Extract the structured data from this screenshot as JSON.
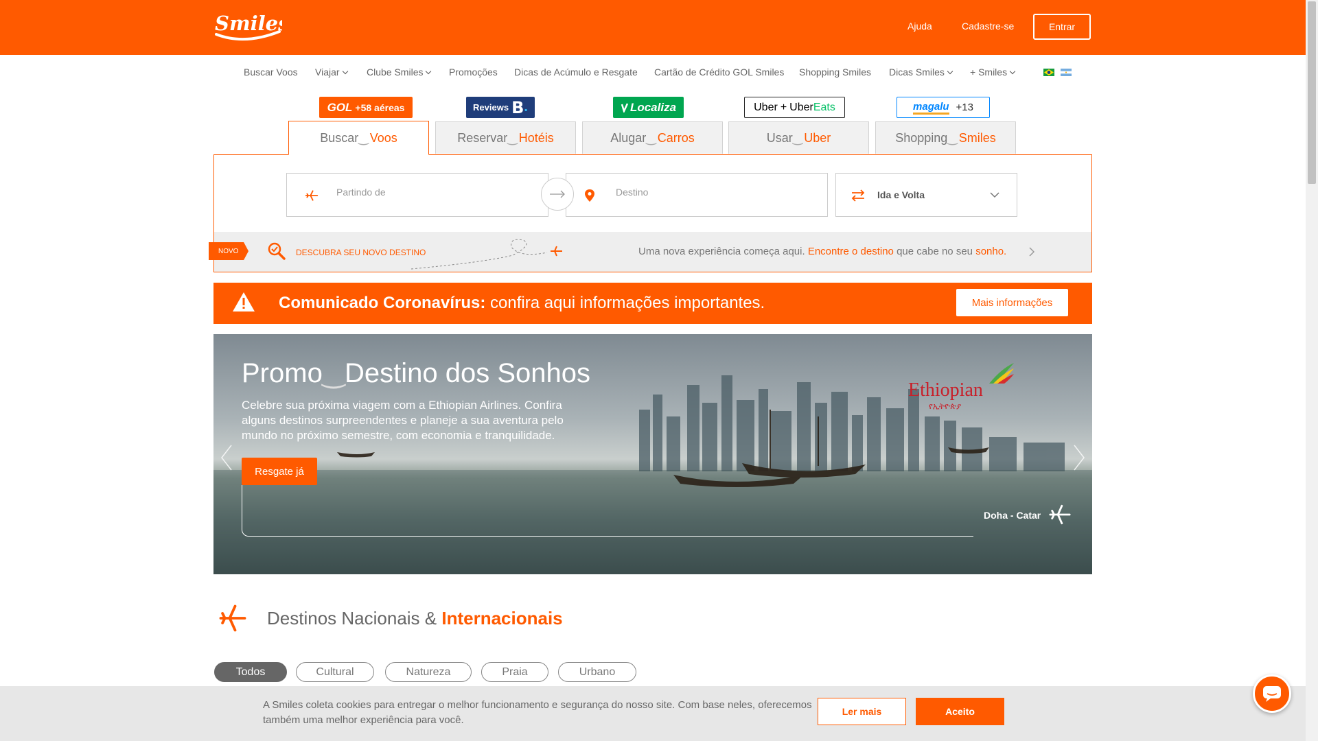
{
  "header": {
    "logo": "Smiles",
    "help": "Ajuda",
    "signup": "Cadastre-se",
    "login": "Entrar"
  },
  "nav": {
    "items": [
      {
        "label": "Buscar Voos",
        "dropdown": false
      },
      {
        "label": "Viajar",
        "dropdown": true
      },
      {
        "label": "Clube Smiles",
        "dropdown": true
      },
      {
        "label": "Promoções",
        "dropdown": false
      },
      {
        "label": "Dicas de Acúmulo e Resgate",
        "dropdown": false
      },
      {
        "label": "Cartão de Crédito GOL Smiles",
        "dropdown": false
      },
      {
        "label": "Shopping Smiles",
        "dropdown": false
      },
      {
        "label": "Dicas Smiles",
        "dropdown": true
      },
      {
        "label": "+ Smiles",
        "dropdown": true
      }
    ],
    "flags": [
      "brazil-flag-icon",
      "argentina-flag-icon"
    ]
  },
  "badges": {
    "gol": {
      "brand": "GOL",
      "text": "+58 aéreas"
    },
    "booking": {
      "brand": "Reviews",
      "letter": "B",
      "dot": "."
    },
    "localiza": {
      "text": "Localiza"
    },
    "uber": {
      "a": "Uber",
      "plus": "+",
      "b": "Uber",
      "c": "Eats"
    },
    "magalu": {
      "brand": "magalu",
      "count": "+13"
    }
  },
  "tabs": [
    {
      "verb": "Buscar",
      "noun": "Voos"
    },
    {
      "verb": "Reservar",
      "noun": "Hotéis"
    },
    {
      "verb": "Alugar",
      "noun": "Carros"
    },
    {
      "verb": "Usar",
      "noun": "Uber"
    },
    {
      "verb": "Shopping",
      "noun": "Smiles"
    }
  ],
  "search": {
    "origin_placeholder": "Partindo de",
    "destination_placeholder": "Destino",
    "trip_type": "Ida e Volta"
  },
  "discover": {
    "badge": "NOVO",
    "link": "DESCUBRA SEU NOVO DESTINO",
    "msg_pre": "Uma nova experiência começa aqui.",
    "msg_link": "Encontre o destino",
    "msg_mid": "que cabe no seu",
    "msg_end": "sonho."
  },
  "corona": {
    "bold": "Comunicado Coronavírus:",
    "rest": "confira aqui informações importantes.",
    "button": "Mais informações"
  },
  "banner": {
    "title_a": "Promo",
    "title_b": "Destino dos Sonhos",
    "description": "Celebre sua próxima viagem com a Ethiopian Airlines. Confira alguns destinos surpreendentes e planeje a sua aventura pelo mundo no próximo semestre, com economia e tranquilidade.",
    "button": "Resgate já",
    "location": "Doha - Catar",
    "airline": "Ethiopian",
    "airline_script": "የኢትዮጵያ"
  },
  "destinations": {
    "title_a": "Destinos Nacionais &",
    "title_b": "Internacionais",
    "filters": [
      "Todos",
      "Cultural",
      "Natureza",
      "Praia",
      "Urbano"
    ]
  },
  "cookie": {
    "text": "A Smiles coleta cookies para entregar o melhor funcionamento e segurança do nosso site. Com base neles, oferecemos também uma melhor experiência para você.",
    "more": "Ler mais",
    "accept": "Aceito"
  },
  "colors": {
    "brand": "#ff5a00",
    "gol": "#ff5a00",
    "booking": "#1f3d7a",
    "localiza": "#00a650",
    "uber": "#000000",
    "magalu": "#0086ff"
  }
}
